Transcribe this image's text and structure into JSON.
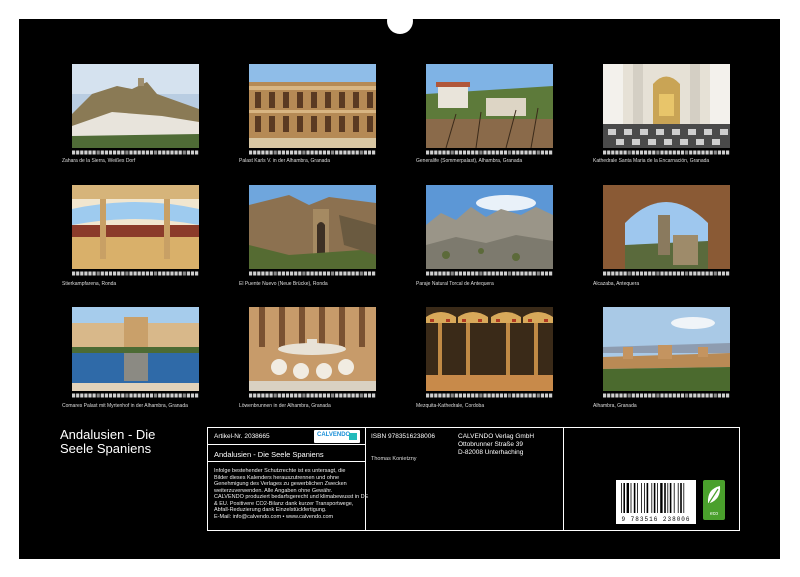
{
  "cover": {
    "title_line1": "Andalusien - Die",
    "title_line2": "Seele Spaniens"
  },
  "photos": [
    {
      "caption": "Zahara de la Sierra, Weißes Dorf",
      "icon": "village-hill-icon"
    },
    {
      "caption": "Palast Karls V. in der Alhambra, Granada",
      "icon": "palace-courtyard-icon"
    },
    {
      "caption": "Generalife (Sommerpalast), Alhambra, Granada",
      "icon": "garden-icon"
    },
    {
      "caption": "Kathedrale Santa Maria de la Encarnación, Granada",
      "icon": "cathedral-interior-icon"
    },
    {
      "caption": "Stierkampfarena, Ronda",
      "icon": "bullring-icon"
    },
    {
      "caption": "El Puente Nuevo (Neue Brücke), Ronda",
      "icon": "bridge-gorge-icon"
    },
    {
      "caption": "Paraje Natural Torcal de Antequera",
      "icon": "rock-landscape-icon"
    },
    {
      "caption": "Alcazaba, Antequera",
      "icon": "arch-view-icon"
    },
    {
      "caption": "Comares Palast mit Myrtenhof in der Alhambra, Granada",
      "icon": "reflecting-pool-icon"
    },
    {
      "caption": "Löwenbrunnen in der Alhambra, Granada",
      "icon": "lion-fountain-icon"
    },
    {
      "caption": "Mezquita-Kathedrale, Cordoba",
      "icon": "mosque-arches-icon"
    },
    {
      "caption": "Alhambra, Granada",
      "icon": "fortress-panorama-icon"
    }
  ],
  "info": {
    "article_label": "Artikel-Nr. 2038665",
    "logo_text": "CALVENDO",
    "title": "Andalusien - Die Seele Spaniens",
    "legal_lines": [
      "Infolge bestehender Schutzrechte ist es untersagt, die",
      "Bilder dieses Kalenders herauszutrennen und ohne",
      "Genehmigung des Verlages zu gewerblichen Zwecken",
      "weiterzuverwenden. Alle Angaben ohne Gewähr.",
      "CALVENDO produziert bedarfsgerecht und klimabewusst in DE",
      "& EU. Positivere CO2-Bilanz dank kurzer Transportwege,",
      "Abfall-Reduzierung dank Einzelstückfertigung.",
      "E-Mail: info@calvendo.com • www.calvendo.com"
    ],
    "isbn": "ISBN 9783516238006",
    "author": "Thomas Konietzny",
    "publisher_line1": "CALVENDO Verlag GmbH",
    "publisher_line2": "Ottobrunner Straße 39",
    "publisher_line3": "D-82008 Unterhaching",
    "barcode_number": "9 783516 238006",
    "eco_label": "eco"
  },
  "colors": {
    "sheet": "#000000",
    "page": "#ffffff",
    "eco": "#4aa02c"
  }
}
